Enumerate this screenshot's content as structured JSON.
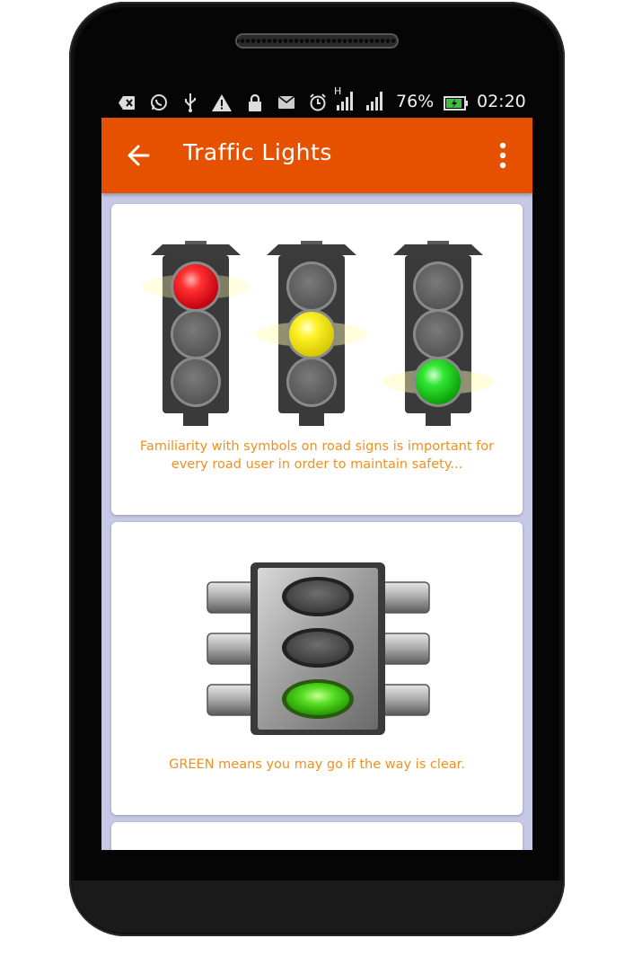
{
  "status_bar": {
    "network_type": "H",
    "battery_percent": "76%",
    "time": "02:20",
    "icons": [
      "notification-icon",
      "whatsapp-icon",
      "usb-icon",
      "warning-icon",
      "lock-icon",
      "mail-icon",
      "alarm-icon",
      "signal-icon",
      "signal-icon-2",
      "battery-icon"
    ]
  },
  "app_bar": {
    "title": "Traffic Lights",
    "back_icon": "back-arrow-icon",
    "menu_icon": "more-vert-icon",
    "color": "#e65100"
  },
  "cards": [
    {
      "image": "three-traffic-lights-red-yellow-green",
      "text": "Familiarity with symbols on road signs is important for every road user in order to maintain safety..."
    },
    {
      "image": "traffic-light-green",
      "text": "GREEN means you may go if the way is clear."
    }
  ],
  "colors": {
    "accent_text": "#f0901e",
    "background": "#c6c9e6",
    "red_light": "#e8202a",
    "yellow_light": "#f5ee1c",
    "green_light": "#2ecf2e"
  }
}
